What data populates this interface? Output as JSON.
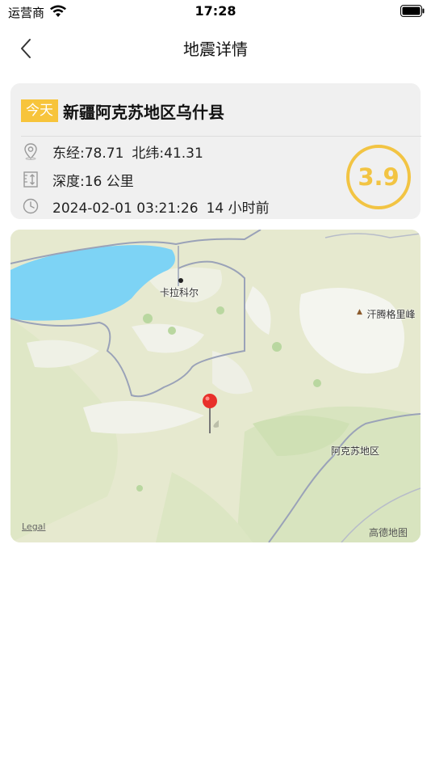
{
  "status_bar": {
    "carrier": "运营商",
    "time": "17:28",
    "wifi_icon": "wifi-icon",
    "battery_icon": "battery-icon"
  },
  "nav": {
    "title": "地震详情",
    "back_icon": "chevron-left-icon"
  },
  "quake": {
    "badge": "今天",
    "location": "新疆阿克苏地区乌什县",
    "longitude": "东经:78.71",
    "latitude": "北纬:41.31",
    "depth": "深度:16 公里",
    "datetime": "2024-02-01 03:21:26",
    "relative_time": "14 小时前",
    "magnitude": "3.9"
  },
  "map": {
    "labels": {
      "city": "卡拉科尔",
      "peak": "汗腾格里峰",
      "region": "阿克苏地区"
    },
    "legal": "Legal",
    "provider": "高德地图"
  },
  "colors": {
    "accent": "#f7c43b",
    "magnitude": "#f2c443",
    "pin": "#e8302a",
    "lake": "#7dd3f5",
    "card_bg": "#f0f0f0"
  }
}
